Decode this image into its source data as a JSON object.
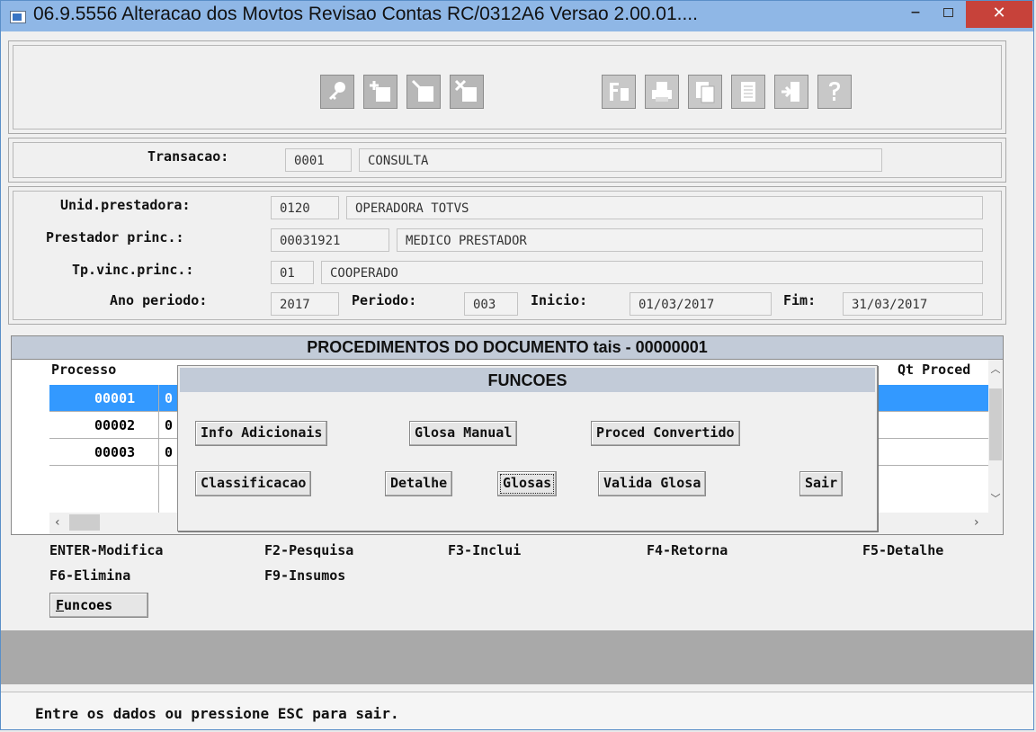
{
  "window": {
    "title": "06.9.5556  Alteracao  dos Movtos Revisao Contas RC/0312A6 Versao 2.00.01....",
    "minimize_glyph": "–",
    "close_glyph": "✕"
  },
  "toolbar": {
    "icons": [
      "key-icon",
      "add-icon",
      "edit-icon",
      "delete-icon",
      "filter-icon",
      "print-icon",
      "copy-icon",
      "document-icon",
      "exit-icon",
      "help-icon"
    ]
  },
  "transacao": {
    "label": "Transacao:",
    "code": "0001",
    "desc": "CONSULTA"
  },
  "header": {
    "unid_label": "Unid.prestadora:",
    "unid_code": "0120",
    "unid_desc": "OPERADORA TOTVS",
    "prest_label": "Prestador princ.:",
    "prest_code": "00031921",
    "prest_desc": "MEDICO PRESTADOR",
    "tpvinc_label": "Tp.vinc.princ.:",
    "tpvinc_code": "01",
    "tpvinc_desc": "COOPERADO",
    "ano_label": "Ano periodo:",
    "ano_value": "2017",
    "periodo_label": "Periodo:",
    "periodo_value": "003",
    "inicio_label": "Inicio:",
    "inicio_value": "01/03/2017",
    "fim_label": "Fim:",
    "fim_value": "31/03/2017"
  },
  "grid": {
    "title": "PROCEDIMENTOS DO DOCUMENTO tais - 00000001",
    "col_processo": "Processo",
    "col_qt": "Qt Proced",
    "rows": [
      {
        "processo": "00001",
        "next": "0"
      },
      {
        "processo": "00002",
        "next": "0"
      },
      {
        "processo": "00003",
        "next": "0"
      }
    ]
  },
  "dialog": {
    "title": "FUNCOES",
    "info": "Info Adicionais",
    "glosa_manual": "Glosa Manual",
    "proced_conv": "Proced Convertido",
    "classificacao": "Classificacao",
    "detalhe": "Detalhe",
    "glosas": "Glosas",
    "valida": "Valida Glosa",
    "sair": "Sair"
  },
  "fkeys": {
    "enter": "ENTER-Modifica",
    "f2": "F2-Pesquisa",
    "f3": "F3-Inclui",
    "f4": "F4-Retorna",
    "f5": "F5-Detalhe",
    "f6": "F6-Elimina",
    "f9": "F9-Insumos"
  },
  "funcoes_button": {
    "hotkey": "F",
    "rest": "uncoes"
  },
  "status": "Entre os dados ou pressione ESC para sair."
}
